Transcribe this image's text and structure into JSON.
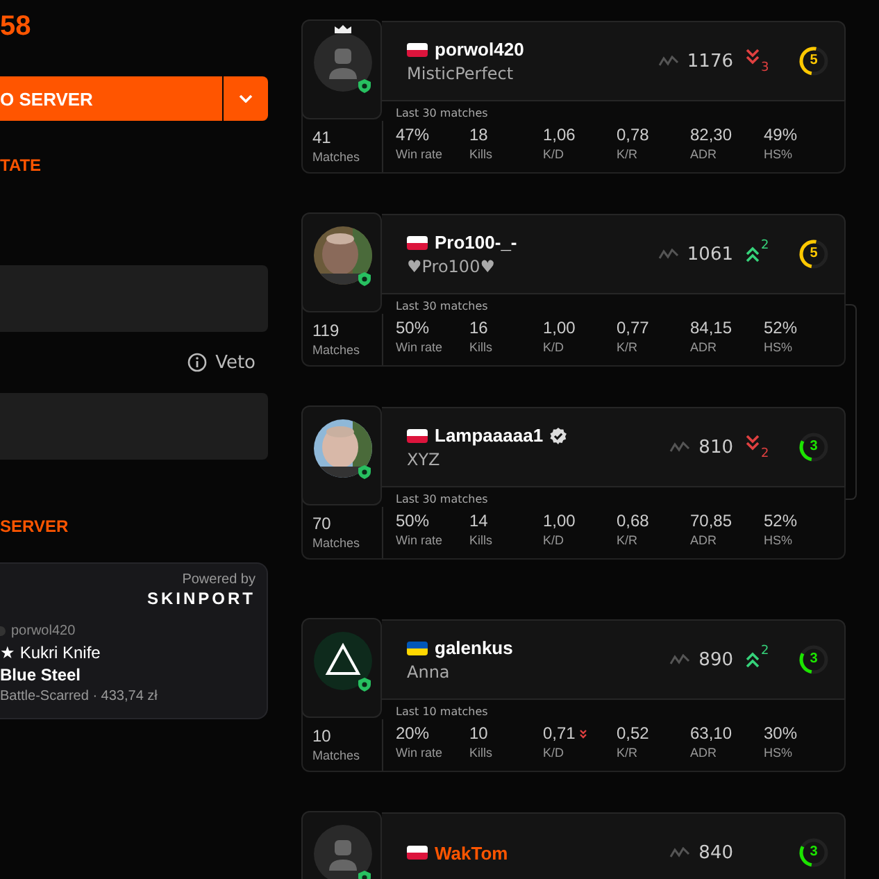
{
  "sidebar": {
    "score": "58",
    "connect_button": {
      "label": "O SERVER"
    },
    "state_link": "TATE",
    "veto_label": "Veto",
    "server_heading": "SERVER",
    "skin_card": {
      "powered_by": "Powered by",
      "brand": "SKINPORT",
      "owner": "porwol420",
      "item": "★ Kukri Knife",
      "finish": "Blue Steel",
      "details": "Battle-Scarred · 433,74 zł"
    }
  },
  "players": [
    {
      "flag": {
        "kind": "pl"
      },
      "name": "porwol420",
      "nickname": "MisticPerfect",
      "highlighted": false,
      "verified": false,
      "crown": true,
      "avatar": {
        "kind": "default"
      },
      "party": false,
      "elo": "1176",
      "trend": {
        "kind": "down",
        "count": "3"
      },
      "level": "5",
      "matches_label": "Last 30 matches",
      "matches": "41",
      "matches_caption": "Matches",
      "stats": [
        {
          "value": "47%",
          "label": "Win rate",
          "down": false
        },
        {
          "value": "18",
          "label": "Kills",
          "down": false
        },
        {
          "value": "1,06",
          "label": "K/D",
          "down": false
        },
        {
          "value": "0,78",
          "label": "K/R",
          "down": false
        },
        {
          "value": "82,30",
          "label": "ADR",
          "down": false
        },
        {
          "value": "49%",
          "label": "HS%",
          "down": false
        }
      ]
    },
    {
      "flag": {
        "kind": "pl"
      },
      "name": "Pro100-_-",
      "nickname": "♥Pro100♥",
      "highlighted": false,
      "verified": false,
      "crown": false,
      "party": true,
      "elo": "1061",
      "trend": {
        "kind": "up",
        "count": "2"
      },
      "level": "5",
      "matches_label": "Last 30 matches",
      "matches": "119",
      "matches_caption": "Matches",
      "stats": [
        {
          "value": "50%",
          "label": "Win rate",
          "down": false
        },
        {
          "value": "16",
          "label": "Kills",
          "down": false
        },
        {
          "value": "1,00",
          "label": "K/D",
          "down": false
        },
        {
          "value": "0,77",
          "label": "K/R",
          "down": false
        },
        {
          "value": "84,15",
          "label": "ADR",
          "down": false
        },
        {
          "value": "52%",
          "label": "HS%",
          "down": false
        }
      ]
    },
    {
      "flag": {
        "kind": "pl"
      },
      "name": "Lampaaaaa1",
      "nickname": "XYZ",
      "highlighted": false,
      "verified": true,
      "crown": false,
      "party": true,
      "elo": "810",
      "trend": {
        "kind": "down",
        "count": "2"
      },
      "level": "3",
      "matches_label": "Last 30 matches",
      "matches": "70",
      "matches_caption": "Matches",
      "stats": [
        {
          "value": "50%",
          "label": "Win rate",
          "down": false
        },
        {
          "value": "14",
          "label": "Kills",
          "down": false
        },
        {
          "value": "1,00",
          "label": "K/D",
          "down": false
        },
        {
          "value": "0,68",
          "label": "K/R",
          "down": false
        },
        {
          "value": "70,85",
          "label": "ADR",
          "down": false
        },
        {
          "value": "52%",
          "label": "HS%",
          "down": false
        }
      ]
    },
    {
      "flag": {
        "kind": "ua"
      },
      "name": "galenkus",
      "nickname": "Anna",
      "highlighted": false,
      "verified": false,
      "crown": false,
      "avatar": {
        "kind": "triangle"
      },
      "party": false,
      "elo": "890",
      "trend": {
        "kind": "up",
        "count": "2"
      },
      "level": "3",
      "matches_label": "Last 10 matches",
      "matches": "10",
      "matches_caption": "Matches",
      "stats": [
        {
          "value": "20%",
          "label": "Win rate",
          "down": false
        },
        {
          "value": "10",
          "label": "Kills",
          "down": false
        },
        {
          "value": "0,71",
          "label": "K/D",
          "down": true
        },
        {
          "value": "0,52",
          "label": "K/R",
          "down": false
        },
        {
          "value": "63,10",
          "label": "ADR",
          "down": false
        },
        {
          "value": "30%",
          "label": "HS%",
          "down": false
        }
      ]
    },
    {
      "flag": {
        "kind": "pl"
      },
      "name": "WakTom",
      "highlighted": true,
      "verified": false,
      "crown": false,
      "avatar": {
        "kind": "default"
      },
      "party": false,
      "elo": "840",
      "level": "3"
    }
  ]
}
